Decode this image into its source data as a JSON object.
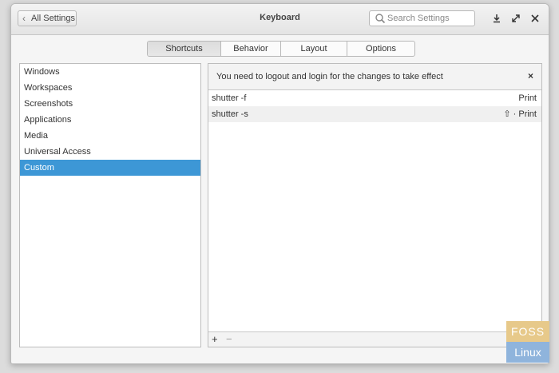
{
  "window": {
    "title": "Keyboard",
    "back_label": "All Settings",
    "search_placeholder": "Search Settings",
    "icons": [
      "download-icon",
      "maximize-icon",
      "close-icon"
    ]
  },
  "tabs": [
    {
      "label": "Shortcuts",
      "active": true
    },
    {
      "label": "Behavior",
      "active": false
    },
    {
      "label": "Layout",
      "active": false
    },
    {
      "label": "Options",
      "active": false
    }
  ],
  "sidebar": {
    "items": [
      {
        "label": "Windows"
      },
      {
        "label": "Workspaces"
      },
      {
        "label": "Screenshots"
      },
      {
        "label": "Applications"
      },
      {
        "label": "Media"
      },
      {
        "label": "Universal Access"
      },
      {
        "label": "Custom",
        "selected": true
      }
    ]
  },
  "content": {
    "banner_text": "You need to logout and login for the changes to take effect",
    "banner_close": "×",
    "shortcuts": [
      {
        "command": "shutter -f",
        "key": "Print"
      },
      {
        "command": "shutter -s",
        "key": "⇧ · Print"
      }
    ],
    "add_label": "+",
    "remove_label": "−"
  },
  "watermark": {
    "top": "FOSS",
    "bottom": "Linux"
  },
  "colors": {
    "accent": "#3d97d6",
    "watermark_top": "#e7c98a",
    "watermark_bottom": "#8fb4dc"
  }
}
